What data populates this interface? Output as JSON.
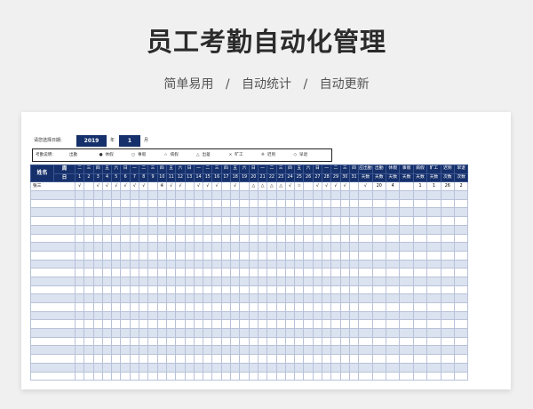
{
  "page": {
    "title": "员工考勤自动化管理",
    "subtitle_parts": [
      "简单易用",
      "自动统计",
      "自动更新"
    ],
    "subtitle_separator": "/"
  },
  "date_selector": {
    "prompt": "请您选择日期:",
    "year": "2019",
    "year_unit": "年",
    "month": "1",
    "month_unit": "月"
  },
  "legend": {
    "label": "考勤说明:",
    "items": [
      {
        "symbol": "",
        "text": "出勤"
      },
      {
        "symbol": "●",
        "text": "休假"
      },
      {
        "symbol": "○",
        "text": "事假"
      },
      {
        "symbol": "☆",
        "text": "病假"
      },
      {
        "symbol": "△",
        "text": "出差"
      },
      {
        "symbol": "×",
        "text": "旷工"
      },
      {
        "symbol": "※",
        "text": "迟到"
      },
      {
        "symbol": "◇",
        "text": "早退"
      }
    ]
  },
  "table": {
    "name_header": "姓名",
    "week_label": "周",
    "day_label": "日",
    "weekdays": [
      "二",
      "三",
      "四",
      "五",
      "六",
      "日",
      "一",
      "二",
      "三",
      "四",
      "五",
      "六",
      "日",
      "一",
      "二",
      "三",
      "四",
      "五",
      "六",
      "日",
      "一",
      "二",
      "三",
      "四",
      "五",
      "六",
      "日",
      "一",
      "二",
      "三",
      "四"
    ],
    "days": [
      "1",
      "2",
      "3",
      "4",
      "5",
      "6",
      "7",
      "8",
      "9",
      "10",
      "11",
      "12",
      "13",
      "14",
      "15",
      "16",
      "17",
      "18",
      "19",
      "20",
      "21",
      "22",
      "23",
      "24",
      "25",
      "26",
      "27",
      "28",
      "29",
      "30",
      "31"
    ],
    "summary_headers": [
      {
        "top": "应出勤",
        "bottom": "天数"
      },
      {
        "top": "出勤",
        "bottom": "天数"
      },
      {
        "top": "休假",
        "bottom": "天数"
      },
      {
        "top": "事假",
        "bottom": "天数"
      },
      {
        "top": "病假",
        "bottom": "天数"
      },
      {
        "top": "旷工",
        "bottom": "天数"
      },
      {
        "top": "迟到",
        "bottom": "次数"
      },
      {
        "top": "早退",
        "bottom": "次数"
      }
    ],
    "empty_rows": 22,
    "rows": [
      {
        "name": "张三",
        "marks": [
          "√",
          "",
          "√",
          "√",
          "√",
          "√",
          "√",
          "√",
          "",
          "※",
          "√",
          "√",
          "",
          "√",
          "√",
          "√",
          "",
          "√",
          "",
          "△",
          "△",
          "△",
          "△",
          "√",
          "☆",
          "",
          "√",
          "√",
          "√",
          "√",
          ""
        ],
        "summary": [
          "√",
          "20",
          "4",
          "",
          "1",
          "1",
          "26",
          "2"
        ]
      }
    ]
  }
}
